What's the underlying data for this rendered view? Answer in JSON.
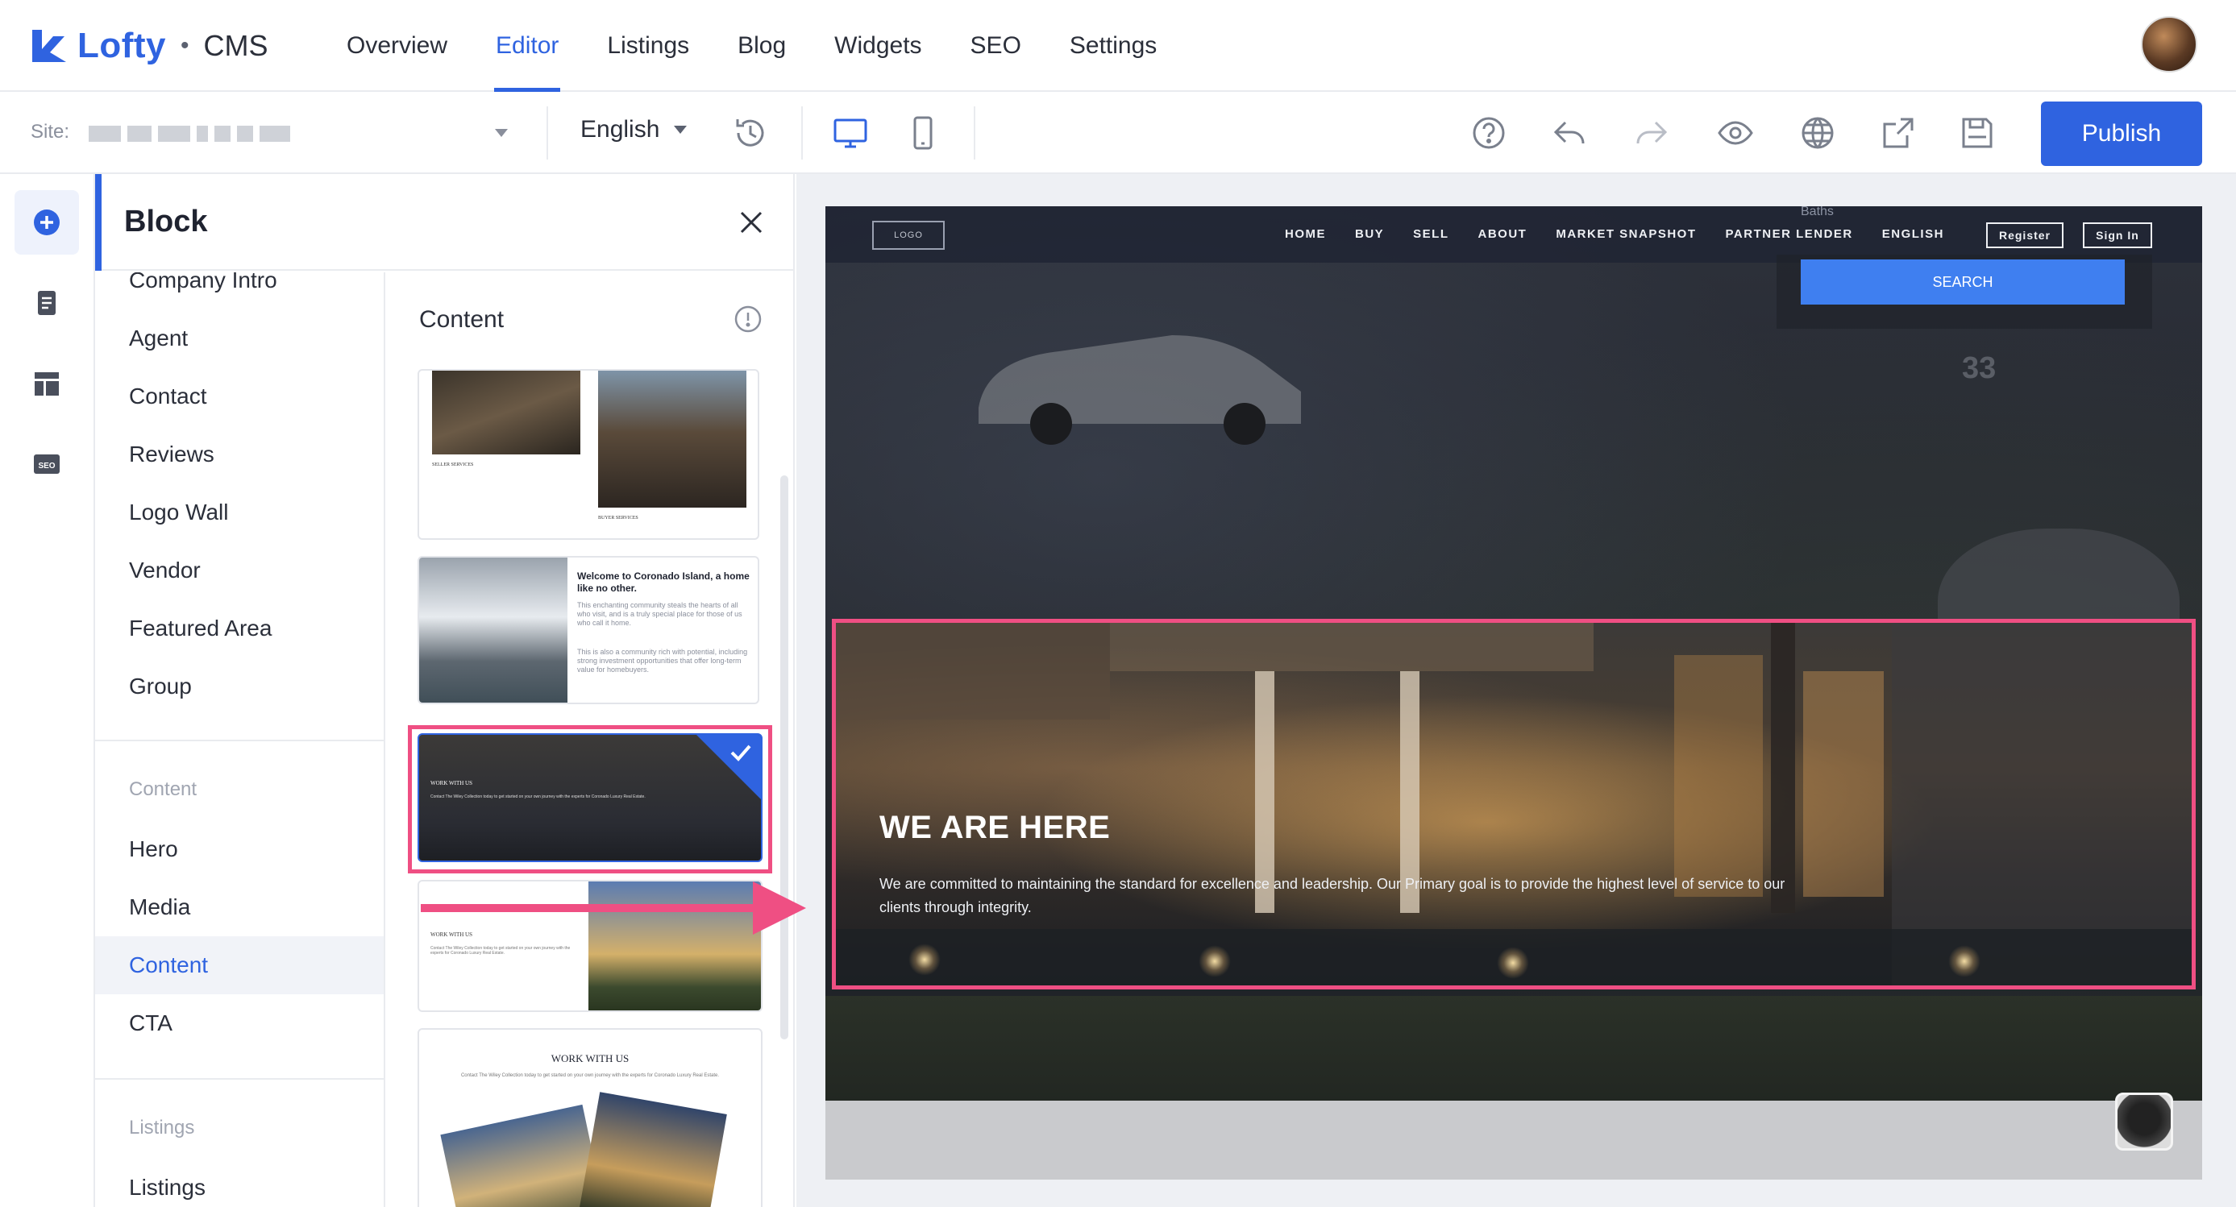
{
  "app": {
    "brand": "Lofty",
    "separator": "•",
    "product": "CMS"
  },
  "nav": {
    "items": [
      "Overview",
      "Editor",
      "Listings",
      "Blog",
      "Widgets",
      "SEO",
      "Settings"
    ],
    "active": "Editor"
  },
  "toolbar": {
    "site_label": "Site:",
    "language": "English",
    "publish_label": "Publish",
    "icons": [
      "history-icon",
      "desktop-icon",
      "mobile-icon",
      "help-icon",
      "undo-icon",
      "redo-icon",
      "preview-icon",
      "globe-icon",
      "export-icon",
      "save-icon"
    ]
  },
  "rail": {
    "icons": [
      "add-block-icon",
      "pages-icon",
      "layout-icon",
      "seo-icon"
    ],
    "seo_text": "SEO"
  },
  "panel": {
    "title": "Block",
    "categories_top": [
      "Company Intro",
      "Agent",
      "Contact",
      "Reviews",
      "Logo Wall",
      "Vendor",
      "Featured Area",
      "Group"
    ],
    "content_group": "Content",
    "content_items": [
      "Hero",
      "Media",
      "Content",
      "CTA"
    ],
    "active_item": "Content",
    "listings_group": "Listings",
    "listings_items": [
      "Listings"
    ],
    "thumbs_title": "Content"
  },
  "thumbs": {
    "t1": {
      "label_left": "SELLER SERVICES",
      "label_right": "BUYER SERVICES"
    },
    "t2": {
      "heading": "Welcome to Coronado Island, a home like no other.",
      "p1": "This enchanting community steals the hearts of all who visit, and is a truly special place for those of us who call it home.",
      "p2": "This is also a community rich with potential, including strong investment opportunities that offer long-term value for homebuyers."
    },
    "t3": {
      "label": "WORK WITH US",
      "text": "Contact The Wiley Collection today to get started on your own journey with the experts for Coronado Luxury Real Estate."
    },
    "t4": {
      "label": "WORK WITH US",
      "text": "Contact The Wiley Collection today to get started on your own journey with the experts for Coronado Luxury Real Estate."
    },
    "t5": {
      "label": "WORK WITH US",
      "text": "Contact The Wiley Collection today to get started on your own journey with the experts for Coronado Luxury Real Estate."
    }
  },
  "preview": {
    "logo": "LOGO",
    "links": [
      "HOME",
      "BUY",
      "SELL",
      "ABOUT",
      "MARKET SNAPSHOT",
      "PARTNER LENDER",
      "ENGLISH"
    ],
    "register": "Register",
    "sign_in": "Sign In",
    "baths": "Baths",
    "search": "SEARCH",
    "house_number": "33",
    "block_title": "WE ARE HERE",
    "block_desc": "We are committed to maintaining the standard for excellence and leadership. Our Primary goal is to provide the highest level of service to our clients through integrity."
  },
  "colors": {
    "accent": "#2f63e0",
    "highlight": "#ef4f83",
    "search": "#3f7ff0"
  }
}
